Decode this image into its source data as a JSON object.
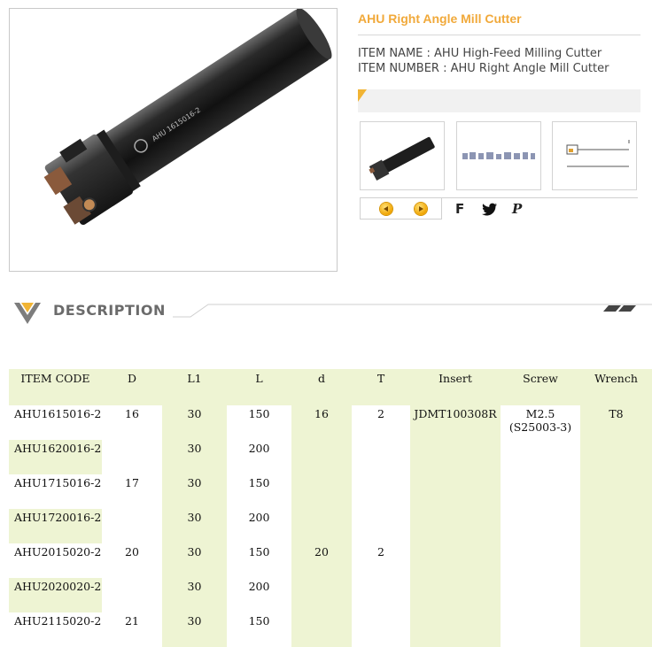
{
  "product": {
    "title": "AHU Right Angle Mill Cutter",
    "item_name": "ITEM NAME : AHU High-Feed Milling Cutter",
    "item_number": "ITEM NUMBER : AHU Right Angle Mill Cutter",
    "tool_marking": "AHU 1615016-2"
  },
  "thumbnails": [
    {
      "label": "cutter-photo"
    },
    {
      "label": "insert-lineup"
    },
    {
      "label": "dimension-drawing"
    }
  ],
  "share": {
    "facebook": "F",
    "twitter": "twitter",
    "pinterest": "P"
  },
  "description": {
    "heading": "DESCRIPTION"
  },
  "table": {
    "headers": [
      "ITEM CODE",
      "D",
      "L1",
      "L",
      "d",
      "T",
      "Insert",
      "Screw",
      "Wrench"
    ],
    "rows": [
      {
        "code": "AHU1615016-2",
        "D": "16",
        "L1": "30",
        "L": "150",
        "d": "16",
        "T": "2",
        "insert": "JDMT100308R",
        "screw_1": "M2.5",
        "screw_2": "(S25003-3)",
        "wrench": "T8"
      },
      {
        "code": "AHU1620016-2",
        "D": "",
        "L1": "30",
        "L": "200",
        "d": "",
        "T": "",
        "insert": "",
        "screw_1": "",
        "screw_2": "",
        "wrench": ""
      },
      {
        "code": "AHU1715016-2",
        "D": "17",
        "L1": "30",
        "L": "150",
        "d": "",
        "T": "",
        "insert": "",
        "screw_1": "",
        "screw_2": "",
        "wrench": ""
      },
      {
        "code": "AHU1720016-2",
        "D": "",
        "L1": "30",
        "L": "200",
        "d": "",
        "T": "",
        "insert": "",
        "screw_1": "",
        "screw_2": "",
        "wrench": ""
      },
      {
        "code": "AHU2015020-2",
        "D": "20",
        "L1": "30",
        "L": "150",
        "d": "20",
        "T": "2",
        "insert": "",
        "screw_1": "",
        "screw_2": "",
        "wrench": ""
      },
      {
        "code": "AHU2020020-2",
        "D": "",
        "L1": "30",
        "L": "200",
        "d": "",
        "T": "",
        "insert": "",
        "screw_1": "",
        "screw_2": "",
        "wrench": ""
      },
      {
        "code": "AHU2115020-2",
        "D": "21",
        "L1": "30",
        "L": "150",
        "d": "",
        "T": "",
        "insert": "",
        "screw_1": "",
        "screw_2": "",
        "wrench": ""
      }
    ]
  },
  "colors": {
    "accent": "#f1a93a",
    "table_tint": "#eef4d3"
  }
}
